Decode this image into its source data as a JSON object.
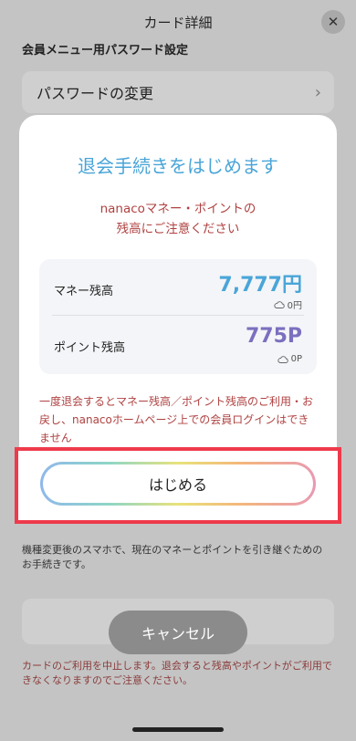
{
  "header": {
    "title": "カード詳細",
    "close_symbol": "✕"
  },
  "background": {
    "section_label": "会員メニュー用パスワード設定",
    "password_row_label": "パスワードの変更",
    "transfer_note": "機種変更後のスマホで、現在のマネーとポイントを引き継ぐためのお手続きです。",
    "cancel_button_label": "キャンセル",
    "cancel_warning": "カードのご利用を中止します。退会すると残高やポイントがご利用できなくなりますのでご注意ください。"
  },
  "modal": {
    "title": "退会手続きをはじめます",
    "caution_line1": "nanacoマネー・ポイントの",
    "caution_line2": "残高にご注意ください",
    "money": {
      "label": "マネー残高",
      "value": "7,777円",
      "sub": "0円"
    },
    "points": {
      "label": "ポイント残高",
      "value": "775P",
      "sub": "0P"
    },
    "warning": "一度退会するとマネー残高／ポイント残高のご利用・お戻し、nanacoホームページ上での会員ログインはできません",
    "start_button_label": "はじめる"
  },
  "colors": {
    "title_blue": "#4aa5d8",
    "caution_red": "#b04141",
    "point_purple": "#7b6fbf",
    "highlight_red": "#ee3a4b"
  }
}
